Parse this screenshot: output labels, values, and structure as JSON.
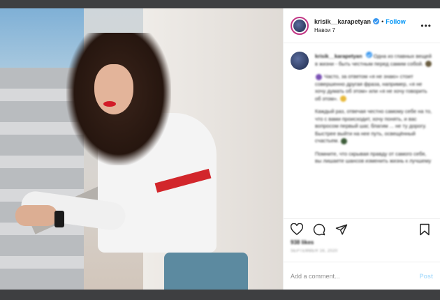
{
  "header": {
    "username": "krisik__karapetyan",
    "separator": "•",
    "follow_label": "Follow",
    "location": "Навои 7",
    "more_label": "•••"
  },
  "caption": {
    "username": "krisik__karapetyan",
    "paragraphs": [
      "Одна из главных вещей в жизни - быть честным перед самим собой.",
      "Часто, за ответом «я не знаю» стоит совершенно другая фраза, например, «я не хочу думать об этом» или «я не хочу говорить об этом».",
      "Каждый раз, отвечая честно самому себе на то, что с вами происходит, хочу понять, и вас вопросом первый шаг, благим ... не ту дорогу. Быстрее выйти на нее путь, освещённый счастьем.",
      "Помните, что скрывая правду от самого себя, вы лишаете шансов изменить жизнь к лучшему"
    ]
  },
  "icons": {
    "heart": "heart-icon",
    "comment": "comment-icon",
    "share": "share-icon",
    "save": "bookmark-icon"
  },
  "likes": "938 likes",
  "date": "SEPTEMBER 16, 2020",
  "add_comment": {
    "placeholder": "Add a comment...",
    "post_label": "Post"
  },
  "colors": {
    "accent": "#0095f6",
    "post_disabled": "#b2dffc",
    "overlay": "#3e3f41"
  }
}
